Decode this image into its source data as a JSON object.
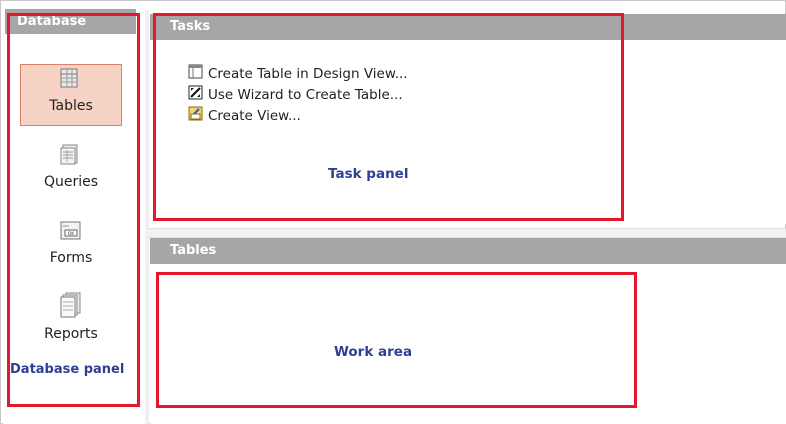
{
  "database_panel": {
    "header": "Database",
    "items": [
      {
        "label": "Tables",
        "icon": "tables-icon",
        "selected": true
      },
      {
        "label": "Queries",
        "icon": "queries-icon",
        "selected": false
      },
      {
        "label": "Forms",
        "icon": "forms-icon",
        "selected": false
      },
      {
        "label": "Reports",
        "icon": "reports-icon",
        "selected": false
      }
    ],
    "annotation": "Database panel"
  },
  "tasks": {
    "header": "Tasks",
    "links": [
      {
        "label": "Create Table in Design View...",
        "icon": "design-view-icon"
      },
      {
        "label": "Use Wizard to Create Table...",
        "icon": "wizard-icon"
      },
      {
        "label": "Create View...",
        "icon": "create-view-icon"
      }
    ],
    "annotation": "Task panel"
  },
  "tables": {
    "header": "Tables",
    "annotation": "Work area"
  },
  "colors": {
    "header_bg": "#a6a6a6",
    "annotation_text": "#2e3f95",
    "annotation_border": "#e3182d",
    "selected_bg": "#f7d3c6"
  }
}
